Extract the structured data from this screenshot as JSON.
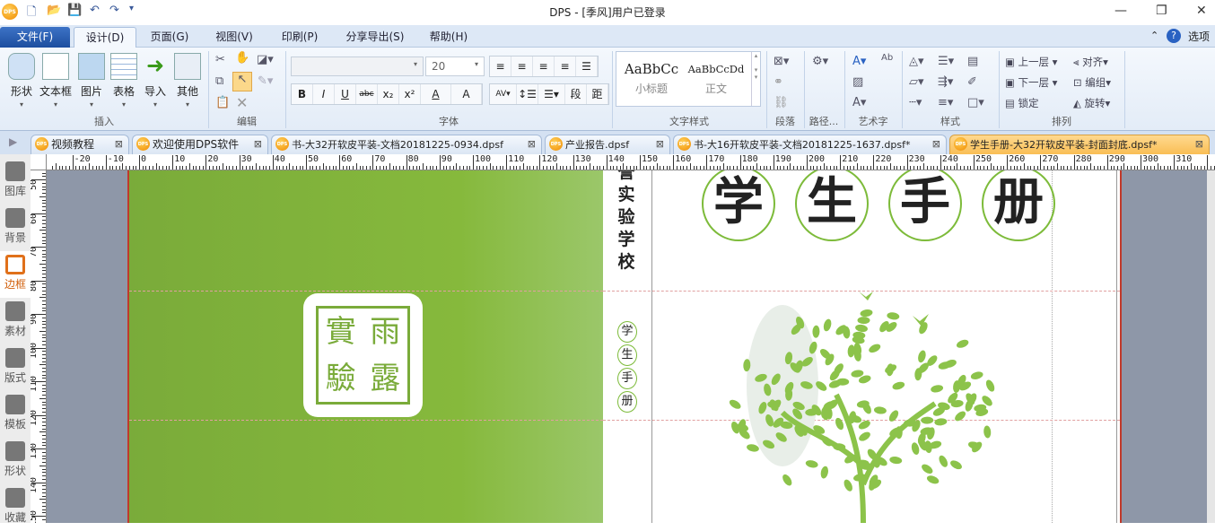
{
  "titlebar": {
    "title": "DPS - [季风]用户已登录",
    "logo": "DPS"
  },
  "menu": {
    "tabs": [
      "文件(F)",
      "设计(D)",
      "页面(G)",
      "视图(V)",
      "印刷(P)",
      "分享导出(S)",
      "帮助(H)"
    ],
    "options": "选项"
  },
  "ribbon": {
    "insert": {
      "items": [
        "形状",
        "文本框",
        "图片",
        "表格",
        "导入",
        "其他"
      ],
      "label": "插入"
    },
    "edit": {
      "label": "编辑"
    },
    "font": {
      "label": "字体",
      "size": "20",
      "buttons": [
        "B",
        "I",
        "U",
        "abc",
        "x₂",
        "x²",
        "A",
        "A"
      ],
      "para_buttons": [
        "段",
        "距"
      ]
    },
    "text_style": {
      "label": "文字样式",
      "styles": [
        {
          "sample": "AaBbCc",
          "name": "小标题"
        },
        {
          "sample": "AaBbCcDd",
          "name": "正文"
        }
      ]
    },
    "paragraph": {
      "label": "段落"
    },
    "path": {
      "label": "路径..."
    },
    "art": {
      "label": "艺术字"
    },
    "style": {
      "label": "样式"
    },
    "arrange": {
      "label": "排列",
      "items": [
        "上一层",
        "对齐",
        "下一层",
        "编组",
        "锁定",
        "旋转"
      ]
    }
  },
  "doc_tabs": [
    {
      "name": "视频教程",
      "active": false
    },
    {
      "name": "欢迎使用DPS软件",
      "active": false
    },
    {
      "name": "书-大32开软皮平装-文档20181225-0934.dpsf",
      "active": false
    },
    {
      "name": "产业报告.dpsf",
      "active": false
    },
    {
      "name": "书-大16开软皮平装-文档20181225-1637.dpsf*",
      "active": false
    },
    {
      "name": "学生手册-大32开软皮平装-封面封底.dpsf*",
      "active": true
    }
  ],
  "sidebar": [
    {
      "label": "图库"
    },
    {
      "label": "背景"
    },
    {
      "label": "边框",
      "active": true
    },
    {
      "label": "素材"
    },
    {
      "label": "版式"
    },
    {
      "label": "模板"
    },
    {
      "label": "形状"
    },
    {
      "label": "收藏"
    }
  ],
  "hruler": {
    "labels": [
      "-20",
      "-10",
      "0",
      "10",
      "20",
      "30",
      "40",
      "50",
      "60",
      "70",
      "80",
      "90",
      "100",
      "110",
      "120",
      "130",
      "140",
      "150",
      "160",
      "170",
      "180",
      "190",
      "200",
      "210",
      "220",
      "230",
      "240",
      "250",
      "260",
      "270",
      "280",
      "290",
      "300",
      "310"
    ]
  },
  "vruler": {
    "labels": [
      "50",
      "60",
      "70",
      "80",
      "90",
      "100",
      "110",
      "120",
      "130",
      "140",
      "150"
    ]
  },
  "document": {
    "seal_text": "雨露實驗",
    "spine_text": [
      "誉",
      "实",
      "验",
      "学",
      "校"
    ],
    "spine_small": [
      "学",
      "生",
      "手",
      "册"
    ],
    "title_chars": [
      "学",
      "生",
      "手",
      "册"
    ],
    "colors": {
      "green": "#7db03c",
      "circle": "#7dbb3a",
      "gray": "#8e97a8"
    }
  }
}
